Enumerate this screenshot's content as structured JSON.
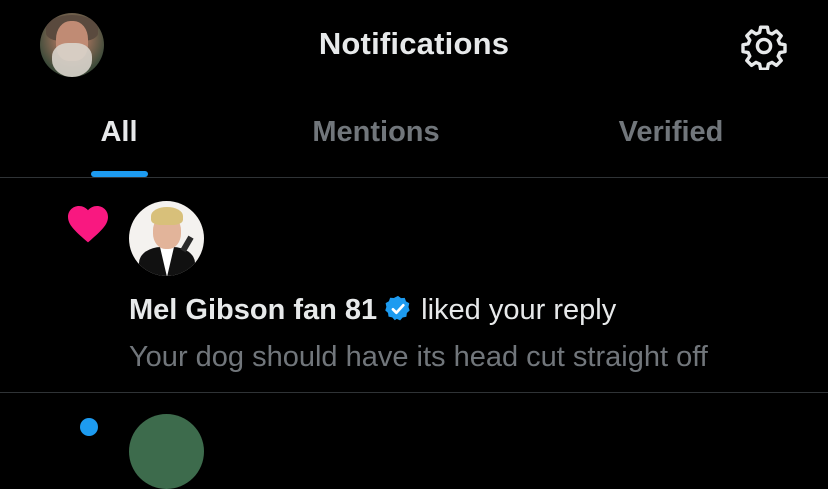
{
  "header": {
    "title": "Notifications",
    "profile_icon": "profile-avatar",
    "settings_icon": "gear-icon"
  },
  "tabs": [
    {
      "label": "All",
      "active": true
    },
    {
      "label": "Mentions",
      "active": false
    },
    {
      "label": "Verified",
      "active": false
    }
  ],
  "notifications": [
    {
      "type_icon": "heart-icon",
      "user": "Mel Gibson fan 81",
      "verified": true,
      "action": "liked your reply",
      "content": "Your dog should have its head cut straight off"
    }
  ],
  "colors": {
    "background": "#000000",
    "text": "#e7e9ea",
    "muted": "#71767b",
    "accent": "#1d9bf0",
    "heart": "#f91880",
    "divider": "#2f3336"
  }
}
